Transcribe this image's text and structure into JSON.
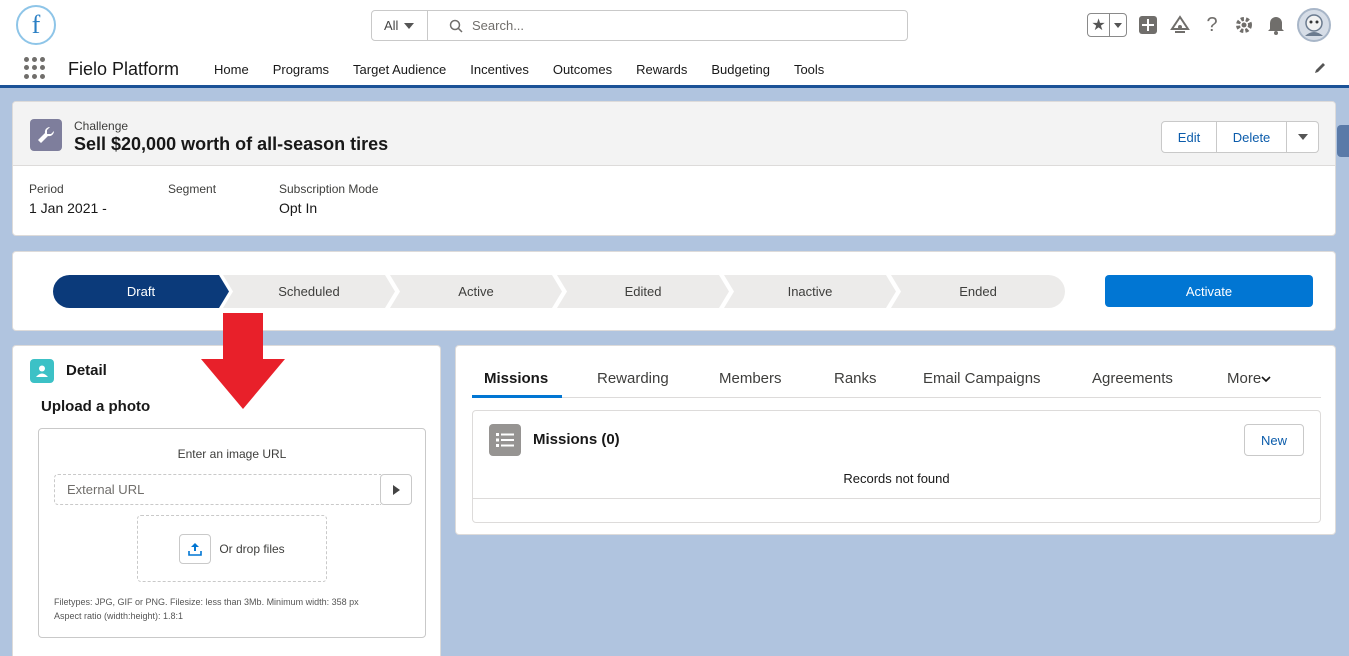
{
  "header": {
    "logo_letter": "f",
    "search_scope": "All",
    "search_placeholder": "Search..."
  },
  "nav": {
    "app_name": "Fielo Platform",
    "items": [
      "Home",
      "Programs",
      "Target Audience",
      "Incentives",
      "Outcomes",
      "Rewards",
      "Budgeting",
      "Tools"
    ]
  },
  "record": {
    "type": "Challenge",
    "title": "Sell $20,000 worth of all-season tires",
    "actions": {
      "edit": "Edit",
      "delete": "Delete"
    },
    "fields": [
      {
        "label": "Period",
        "value": "1 Jan 2021 -"
      },
      {
        "label": "Segment",
        "value": ""
      },
      {
        "label": "Subscription Mode",
        "value": "Opt In"
      }
    ]
  },
  "path": {
    "steps": [
      "Draft",
      "Scheduled",
      "Active",
      "Edited",
      "Inactive",
      "Ended"
    ],
    "current_index": 0,
    "action_label": "Activate"
  },
  "detail": {
    "title": "Detail",
    "upload_title": "Upload a photo",
    "url_label": "Enter an image URL",
    "url_placeholder": "External URL",
    "drop_label": "Or drop files",
    "hint_line1": "Filetypes: JPG, GIF or PNG. Filesize: less than 3Mb. Minimum width: 358 px",
    "hint_line2": "Aspect ratio (width:height): 1.8:1"
  },
  "tabs": {
    "items": [
      "Missions",
      "Rewarding",
      "Members",
      "Ranks",
      "Email Campaigns",
      "Agreements",
      "More"
    ],
    "active_index": 0
  },
  "related": {
    "title": "Missions (0)",
    "new_label": "New",
    "empty_text": "Records not found"
  },
  "colors": {
    "brand_blue": "#0176d3",
    "path_current": "#0b3a7a",
    "annotation_arrow": "#e8202a",
    "page_bg": "#b0c4df"
  }
}
